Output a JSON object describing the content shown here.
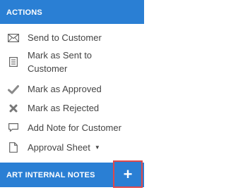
{
  "actions": {
    "title": "ACTIONS",
    "items": [
      {
        "label": "Send to Customer",
        "icon": "envelope-icon"
      },
      {
        "label": "Mark as Sent to Customer",
        "line1": "Mark as Sent to",
        "line2": "Customer",
        "icon": "document-list-icon"
      },
      {
        "label": "Mark as Approved",
        "icon": "checkmark-icon"
      },
      {
        "label": "Mark as Rejected",
        "icon": "x-mark-icon"
      },
      {
        "label": "Add Note for Customer",
        "icon": "speech-bubble-icon"
      },
      {
        "label": "Approval Sheet",
        "icon": "file-icon",
        "dropdown_glyph": "▼"
      }
    ]
  },
  "art_internal_notes": {
    "title": "ART INTERNAL NOTES",
    "add_button_glyph": "+"
  },
  "colors": {
    "accent": "#2a7fd4",
    "highlight_border": "#e0484a",
    "text": "#444444",
    "icon": "#666666"
  }
}
